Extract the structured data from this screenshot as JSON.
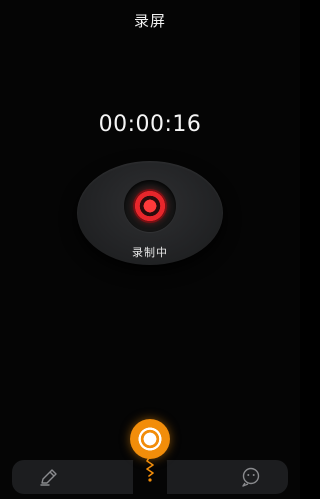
{
  "header": {
    "title": "录屏"
  },
  "recorder": {
    "elapsed": "00:00:16",
    "status_label": "录制中"
  },
  "bottom_nav": {
    "left_icon": "edit-pen-icon",
    "center_icon": "record-mic-icon",
    "right_icon": "chat-face-icon"
  },
  "colors": {
    "background": "#050505",
    "record_red": "#e8262b",
    "accent_orange": "#f28d0a",
    "panel_gray": "#1c1d1f"
  }
}
